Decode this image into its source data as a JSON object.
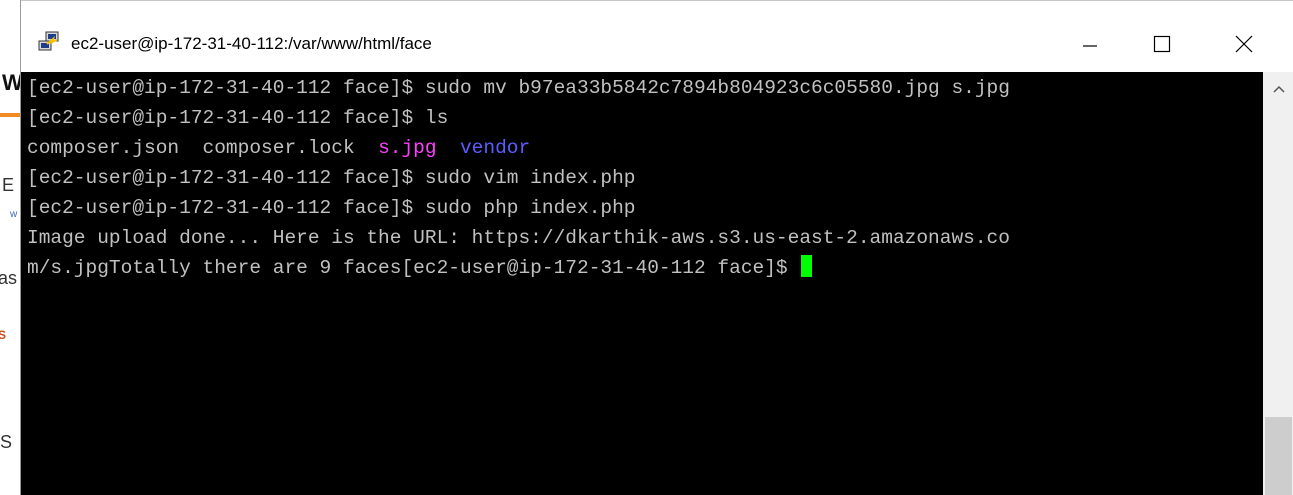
{
  "window": {
    "title": "ec2-user@ip-172-31-40-112:/var/www/html/face",
    "icon": "putty-icon"
  },
  "background_fragments": [
    "W",
    "E",
    "w",
    "as",
    "S",
    "S",
    "(S"
  ],
  "terminal": {
    "colors": {
      "background": "#000000",
      "text": "#c0c0c0",
      "image_file": "#ff3eff",
      "directory": "#5c5cff",
      "cursor": "#00ff00"
    },
    "line1": "[ec2-user@ip-172-31-40-112 face]$ sudo mv b97ea33b5842c7894b804923c6c05580.jpg s.jpg",
    "line2": "[ec2-user@ip-172-31-40-112 face]$ ls",
    "ls_output": {
      "file1": "composer.json",
      "file2": "composer.lock",
      "file3": "s.jpg",
      "file4": "vendor"
    },
    "line4": "[ec2-user@ip-172-31-40-112 face]$ sudo vim index.php",
    "line5": "[ec2-user@ip-172-31-40-112 face]$ sudo php index.php",
    "line6": "Image upload done... Here is the URL: https://dkarthik-aws.s3.us-east-2.amazonaws.co",
    "line7": "m/s.jpgTotally there are 9 faces[ec2-user@ip-172-31-40-112 face]$ "
  },
  "controls": {
    "minimize": "minimize-icon",
    "maximize": "maximize-icon",
    "close": "close-icon",
    "scroll_up": "scroll-up-arrow-icon"
  }
}
